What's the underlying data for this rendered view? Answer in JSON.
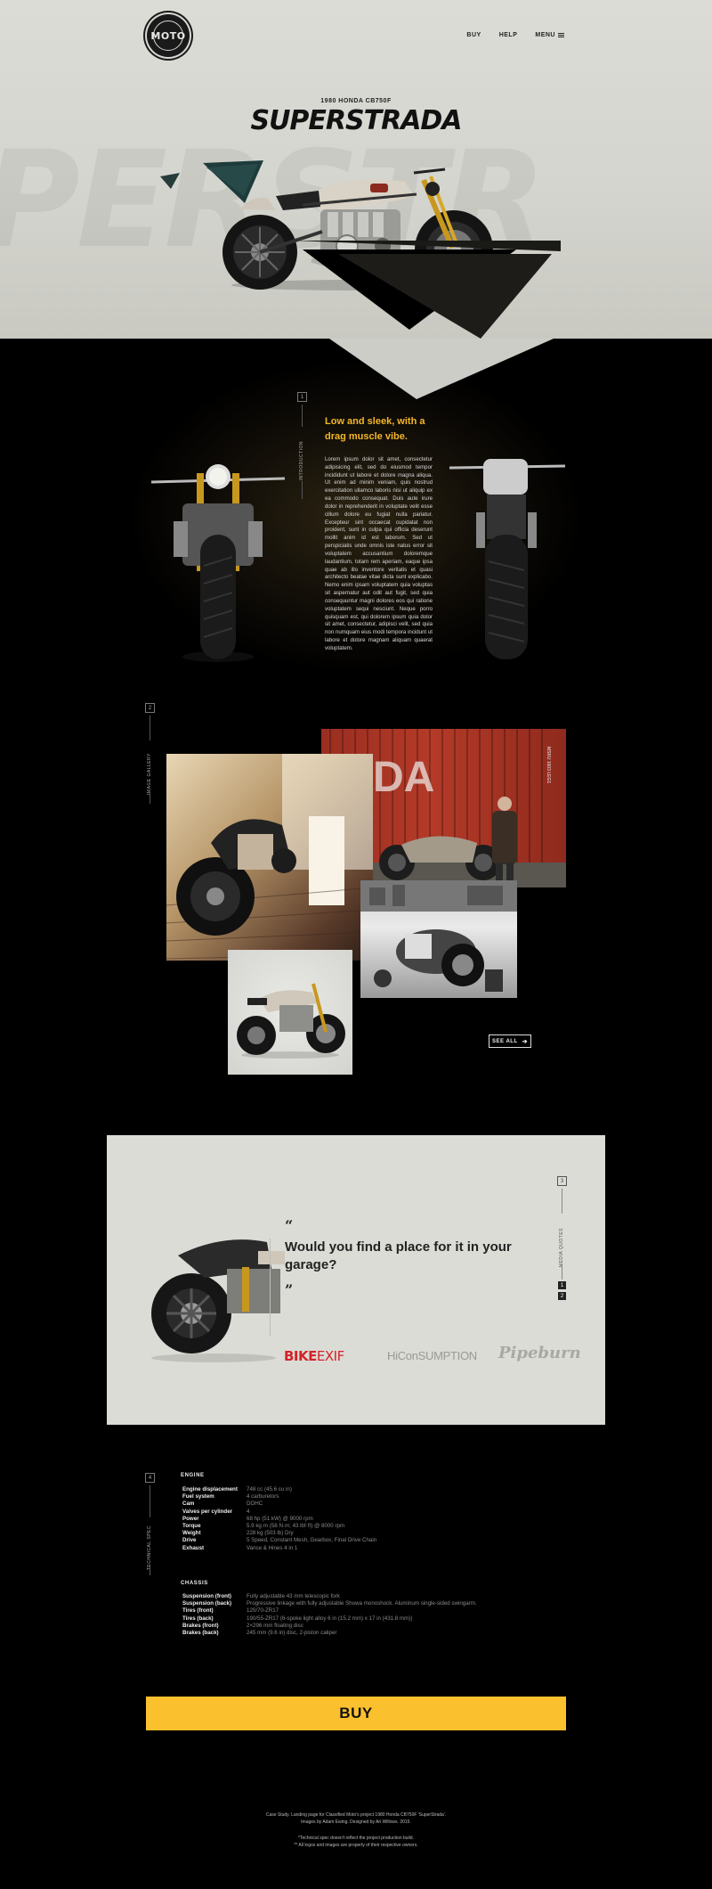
{
  "nav": {
    "logo_text": "MOTO",
    "buy": "BUY",
    "help": "HELP",
    "menu": "MENU"
  },
  "hero": {
    "subtitle": "1980 HONDA CB750F",
    "title": "SUPERSTRADA",
    "background_word": "PERSTR"
  },
  "intro": {
    "section_number": "1",
    "section_label": "INTRODUCTION",
    "heading": "Low and sleek, with a drag muscle vibe.",
    "body": "Lorem ipsum dolor sit amet, consectetur adipisicing elit, sed do eiusmod tempor incididunt ut labore et dolore magna aliqua. Ut enim ad minim veniam, quis nostrud exercitation ullamco laboris nisi ut aliquip ex ea commodo consequat. Duis aute irure dolor in reprehenderit in voluptate velit esse cillum dolore eu fugiat nulla pariatur. Excepteur sint occaecat cupidatat non proident, sunt in culpa qui officia deserunt mollit anim id est laborum. Sed ut perspiciatis unde omnis iste natus error sit voluptatem accusantium doloremque laudantium, totam rem aperiam, eaque ipsa quae ab illo inventore veritatis et quasi architecto beatae vitae dicta sunt explicabo. Nemo enim ipsam voluptatem quia voluptas sit aspernatur aut odit aut fugit, sed quia consequuntur magni dolores eos qui ratione voluptatem sequi nesciunt. Neque porro quisquam est, qui dolorem ipsum quia dolor sit amet, consectetur, adipisci velit, sed quia non numquam eius modi tempora incidunt ut labore et dolore magnam aliquam quaerat voluptatem."
  },
  "gallery": {
    "section_number": "2",
    "section_label": "IMAGE GALLERY",
    "see_all": "SEE ALL",
    "container_text": "DA",
    "container_code": "MSKU 1603 LEG1"
  },
  "quote": {
    "section_number": "3",
    "section_label": "MEDIA QUOTES",
    "open_mark": "“",
    "close_mark": "”",
    "text": "Would you find a place for it in your garage?",
    "page_indicator_1": "1",
    "page_indicator_2": "2",
    "brands": {
      "bikeexif_bold": "BIKE",
      "bikeexif_light": "EXIF",
      "consumption": "ConSUMPTION",
      "consumption_prefix": "Hi",
      "pipeburn": "Pipeburn"
    }
  },
  "specs": {
    "section_number": "4",
    "section_label": "TECHNICAL SPEC",
    "engine_title": "ENGINE",
    "engine": [
      {
        "k": "Engine displacement",
        "v": "748 cc (45.6 cu in)"
      },
      {
        "k": "Fuel system",
        "v": "4 carburetors"
      },
      {
        "k": "Cam",
        "v": "DOHC"
      },
      {
        "k": "Valves per cylinder",
        "v": "4"
      },
      {
        "k": "Power",
        "v": "68 hp (51 kW) @ 9000 rpm"
      },
      {
        "k": "Torque",
        "v": "5.9 kg·m (58 N·m; 43 lbf·ft) @ 8000 rpm"
      },
      {
        "k": "Weight",
        "v": "228 kg (503 lb) Dry"
      },
      {
        "k": "Drive",
        "v": "5 Speed, Constant Mesh, Gearbox, Final Drive Chain"
      },
      {
        "k": "Exhaust",
        "v": "Vance & Hines 4 in 1"
      }
    ],
    "chassis_title": "CHASSIS",
    "chassis": [
      {
        "k": "Suspension (front)",
        "v": "Fully adjustable 43 mm telescopic fork"
      },
      {
        "k": "Suspension (back)",
        "v": "Progressive linkage with fully adjustable Showa monoshock. Aluminum single-sided swingarm."
      },
      {
        "k": "Tires (front)",
        "v": "120/70-ZR17"
      },
      {
        "k": "Tires (back)",
        "v": "190/55-ZR17 (6-spoke light alloy 6 in (15.2 mm) x 17 in (431.8 mm))"
      },
      {
        "k": "Brakes (front)",
        "v": "2×296 mm floating disc"
      },
      {
        "k": "Brakes (back)",
        "v": "245 mm (9.6 in) disc, 2-piston caliper"
      }
    ]
  },
  "buy_button": "BUY",
  "footer": {
    "line1": "Case Study. Landing page for Classified Moto's project 1980 Honda CB750F 'SuperStrada'.",
    "line2": "Images by Adam Ewing. Designed by Ari Willows. 2015.",
    "line3": "*Technical spec doesn't reflect the project production build.",
    "line4": "** All logos and images are property of their respective owners."
  },
  "colors": {
    "accent": "#f3b72a",
    "buy": "#fbc02d",
    "hero_bg": "#d8d8d3",
    "bikeexif_red": "#d2232a"
  }
}
